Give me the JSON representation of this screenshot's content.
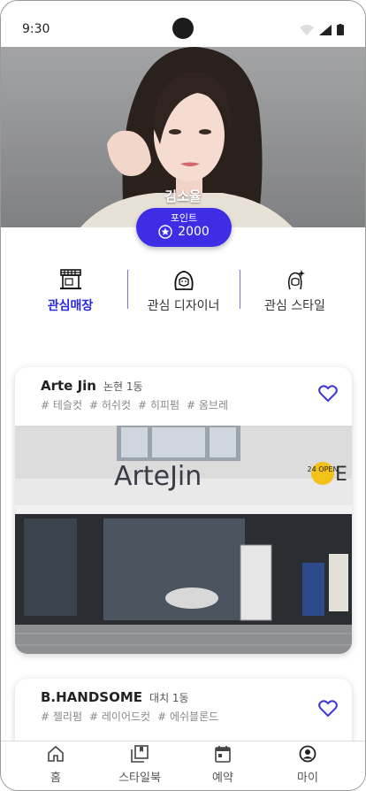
{
  "status": {
    "time": "9:30"
  },
  "profile": {
    "name": "김소율",
    "points_label": "포인트",
    "points_value": "2000"
  },
  "tabs": [
    {
      "label": "관심매장",
      "active": true,
      "icon": "store-icon"
    },
    {
      "label": "관심 디자이너",
      "active": false,
      "icon": "designer-icon"
    },
    {
      "label": "관심 스타일",
      "active": false,
      "icon": "style-icon"
    }
  ],
  "shops": [
    {
      "name": "Arte Jin",
      "location": "논현 1동",
      "tags": [
        "# 테슬컷",
        "# 허쉬컷",
        "# 히피펌",
        "# 옴브레"
      ],
      "sign_text": "ArteJin",
      "badge": "24 OPEN",
      "sign_right": "E"
    },
    {
      "name": "B.HANDSOME",
      "location": "대치 1동",
      "tags": [
        "# 젤리펌",
        "# 레이어드컷",
        "# 에쉬블론드"
      ]
    }
  ],
  "nav": [
    {
      "label": "홈",
      "icon": "home-icon"
    },
    {
      "label": "스타일북",
      "icon": "stylebook-icon"
    },
    {
      "label": "예약",
      "icon": "calendar-icon"
    },
    {
      "label": "마이",
      "icon": "profile-icon"
    }
  ],
  "colors": {
    "accent": "#3d2ee6",
    "active_tab": "#2a2ae0",
    "heart": "#3d35d4"
  }
}
